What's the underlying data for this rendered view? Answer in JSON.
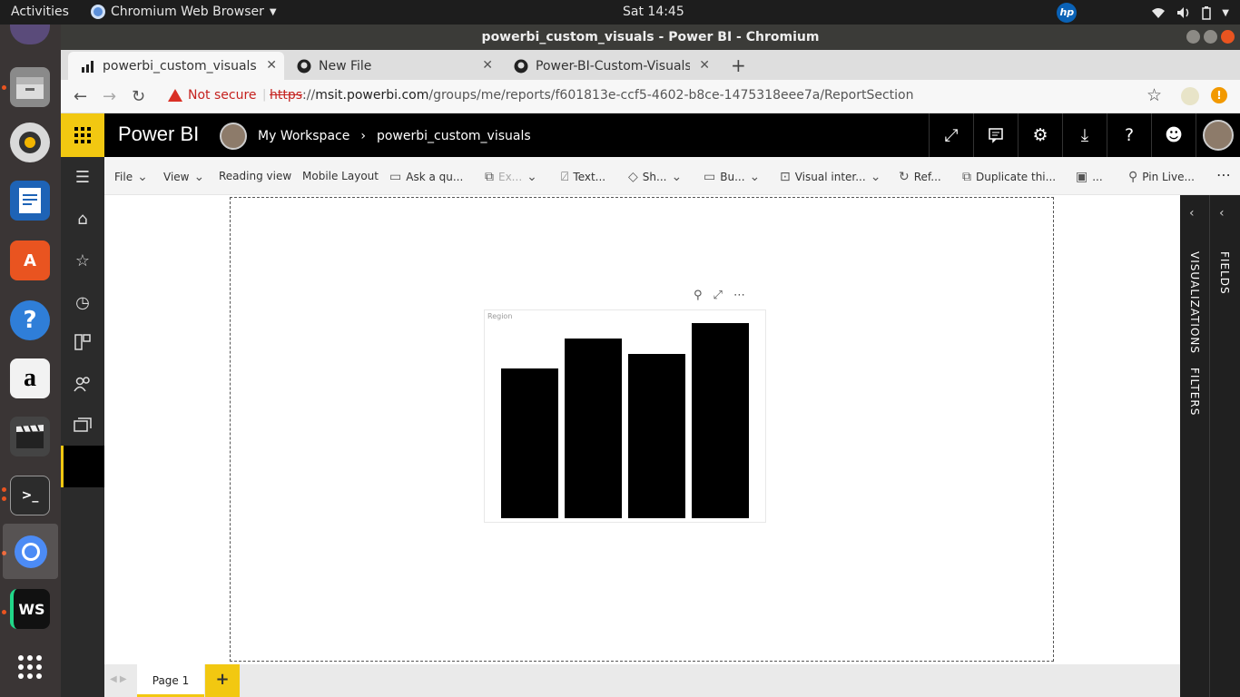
{
  "topbar": {
    "activities": "Activities",
    "app_name": "Chromium Web Browser",
    "clock": "Sat 14:45"
  },
  "window": {
    "title": "powerbi_custom_visuals - Power BI - Chromium"
  },
  "tabs": [
    {
      "title": "powerbi_custom_visuals -",
      "active": true
    },
    {
      "title": "New File",
      "active": false
    },
    {
      "title": "Power-BI-Custom-Visuals",
      "active": false
    }
  ],
  "omnibox": {
    "security": "Not secure",
    "scheme": "https",
    "host": "msit.powerbi.com",
    "path": "/groups/me/reports/f601813e-ccf5-4602-b8ce-1475318eee7a/ReportSection"
  },
  "powerbi": {
    "product": "Power BI",
    "workspace": "My Workspace",
    "report": "powerbi_custom_visuals"
  },
  "commands": [
    {
      "label": "File"
    },
    {
      "label": "View"
    },
    {
      "label": "Reading view"
    },
    {
      "label": "Mobile Layout"
    },
    {
      "label": "Ask a qu..."
    },
    {
      "label": "Ex..."
    },
    {
      "label": "Text..."
    },
    {
      "label": "Sh..."
    },
    {
      "label": "Bu..."
    },
    {
      "label": "Visual inter..."
    },
    {
      "label": "Ref..."
    },
    {
      "label": "Duplicate thi..."
    },
    {
      "label": "..."
    },
    {
      "label": "Pin Live..."
    }
  ],
  "visual": {
    "field_label": "Region"
  },
  "chart_data": {
    "type": "bar",
    "categories": [
      "",
      "",
      "",
      ""
    ],
    "values": [
      165,
      198,
      181,
      215
    ],
    "ylim": [
      0,
      220
    ],
    "grid": false,
    "color": "#000000"
  },
  "page_tabs": [
    {
      "label": "Page 1"
    }
  ],
  "add_page": "+",
  "panes": {
    "visualizations": "VISUALIZATIONS",
    "filters": "FILTERS",
    "fields": "FIELDS"
  },
  "colors": {
    "accent": "#f2c811",
    "warning": "#c5221f",
    "ubuntu": "#e95420"
  }
}
